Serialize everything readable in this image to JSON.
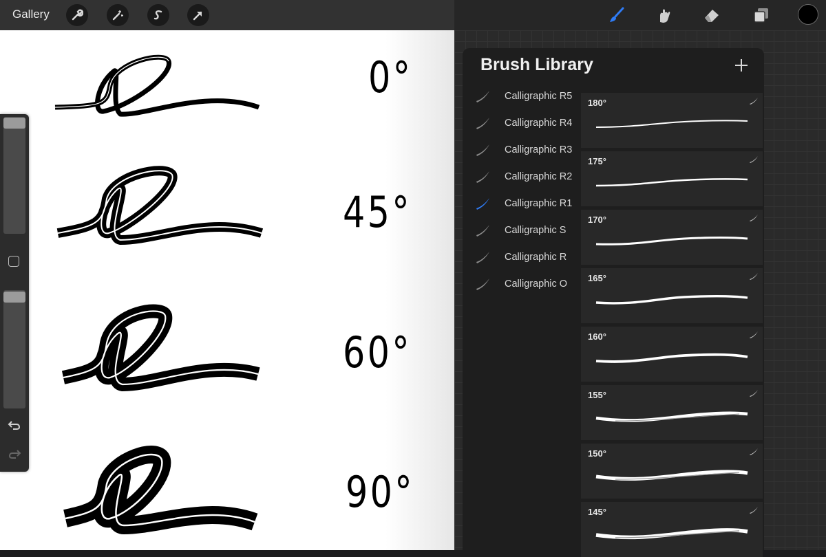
{
  "topbar": {
    "gallery_label": "Gallery",
    "left_tools": [
      "wrench-icon",
      "magic-wand-icon",
      "selection-s-icon",
      "arrow-cursor-icon"
    ],
    "right_tools": [
      "brush-icon",
      "smudge-icon",
      "eraser-icon",
      "layers-icon"
    ],
    "active_tool": "brush-icon",
    "accent_color": "#2f7cf6",
    "current_color": "#000000"
  },
  "canvas": {
    "rows": [
      {
        "angle": "0°"
      },
      {
        "angle": "45°"
      },
      {
        "angle": "60°"
      },
      {
        "angle": "90°"
      }
    ]
  },
  "sidebar": {
    "buttons": [
      "brush-size-slider",
      "modify-square-button",
      "opacity-slider",
      "undo-icon",
      "redo-icon"
    ]
  },
  "panel": {
    "title": "Brush Library",
    "add_button": "+",
    "categories": [
      {
        "label": "Calligraphic R5",
        "active": false
      },
      {
        "label": "Calligraphic R4",
        "active": false
      },
      {
        "label": "Calligraphic R3",
        "active": false
      },
      {
        "label": "Calligraphic R2",
        "active": false
      },
      {
        "label": "Calligraphic R1",
        "active": true
      },
      {
        "label": "Calligraphic S",
        "active": false
      },
      {
        "label": "Calligraphic R",
        "active": false
      },
      {
        "label": "Calligraphic O",
        "active": false
      }
    ],
    "brushes": [
      {
        "name": "180°"
      },
      {
        "name": "175°"
      },
      {
        "name": "170°"
      },
      {
        "name": "165°"
      },
      {
        "name": "160°"
      },
      {
        "name": "155°"
      },
      {
        "name": "150°"
      },
      {
        "name": "145°"
      }
    ]
  }
}
